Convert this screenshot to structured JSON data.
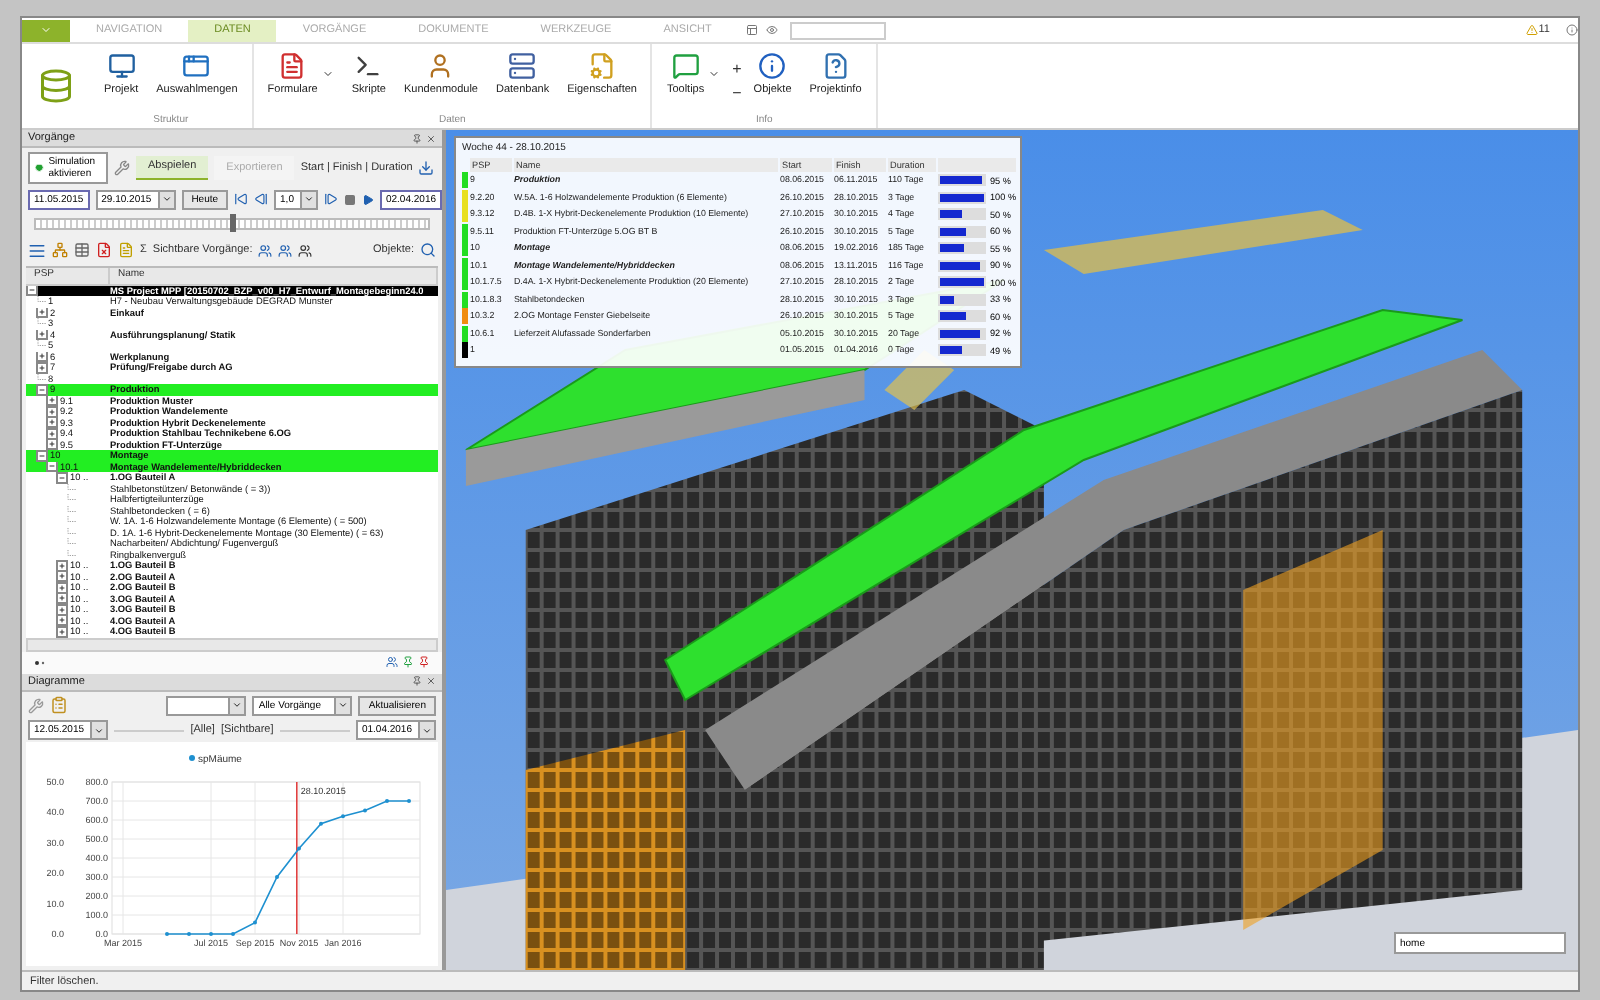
{
  "tabs": [
    {
      "label": "NAVIGATION",
      "selected": false
    },
    {
      "label": "DATEN",
      "selected": true
    },
    {
      "label": "VORGÄNGE",
      "selected": false
    },
    {
      "label": "DOKUMENTE",
      "selected": false
    },
    {
      "label": "WERKZEUGE",
      "selected": false
    },
    {
      "label": "ANSICHT",
      "selected": false
    }
  ],
  "ribbon_groups": [
    {
      "label": "Struktur",
      "buttons": [
        {
          "label": "Projekt",
          "dropdown": false
        },
        {
          "label": "Auswahlmengen",
          "dropdown": false
        }
      ]
    },
    {
      "label": "Daten",
      "buttons": [
        {
          "label": "Formulare",
          "dropdown": true
        },
        {
          "label": "Skripte",
          "dropdown": false
        },
        {
          "label": "Kundenmodule",
          "dropdown": false
        },
        {
          "label": "Datenbank",
          "dropdown": false
        },
        {
          "label": "Eigenschaften",
          "dropdown": false
        }
      ]
    },
    {
      "label": "Info",
      "buttons": [
        {
          "label": "Tooltips",
          "dropdown": true
        },
        {
          "label": "Objekte",
          "dropdown": false
        },
        {
          "label": "Projektinfo",
          "dropdown": false
        }
      ],
      "zoom_in": "+",
      "zoom_out": "−"
    }
  ],
  "warning_count": "11",
  "vorgaenge": {
    "title": "Vorgänge",
    "simulation_button": "Simulation aktivieren",
    "mode_tabs": [
      {
        "label": "Abspielen",
        "selected": true,
        "disabled": false
      },
      {
        "label": "Exportieren",
        "selected": false,
        "disabled": true
      }
    ],
    "display_mode": "Start | Finish | Duration",
    "range_start": "11.05.2015",
    "current_date": "29.10.2015",
    "today_button": "Heute",
    "speed": "1,0",
    "range_end": "02.04.2016",
    "timeline": {
      "level": 0.5
    },
    "sum_symbol": "Σ",
    "visible_tasks_label": "Sichtbare Vorgänge:",
    "objects_label": "Objekte:",
    "tree_columns": [
      "PSP",
      "Name"
    ],
    "tree": [
      {
        "kind": "folder",
        "name": "MS Project MPP [20150702_BZP_v00_H7_Entwurf_Montagebeginn24.0",
        "bold": true,
        "selected": true,
        "highlighted": false,
        "expanded": true,
        "children": [
          {
            "kind": "item",
            "psp": "1",
            "name": "H7 - Neubau Verwaltungsgebäude DEGRAD Munster",
            "bold": false,
            "selected": false,
            "highlighted": false
          },
          {
            "kind": "folder",
            "psp": "2",
            "name": "Einkauf",
            "bold": true,
            "selected": false,
            "highlighted": false,
            "expanded": false
          },
          {
            "kind": "item",
            "psp": "3",
            "selected": false,
            "highlighted": false
          },
          {
            "kind": "folder",
            "psp": "4",
            "name": "Ausführungsplanung/ Statik",
            "bold": true,
            "selected": false,
            "highlighted": false,
            "expanded": false
          },
          {
            "kind": "item",
            "psp": "5",
            "selected": false,
            "highlighted": false
          },
          {
            "kind": "folder",
            "psp": "6",
            "name": "Werkplanung",
            "bold": true,
            "selected": false,
            "highlighted": false,
            "expanded": false
          },
          {
            "kind": "folder",
            "psp": "7",
            "name": "Prüfung/Freigabe durch AG",
            "bold": true,
            "selected": false,
            "highlighted": false,
            "expanded": false
          },
          {
            "kind": "item",
            "psp": "8",
            "selected": false,
            "highlighted": false
          },
          {
            "kind": "folder",
            "psp": "9",
            "name": "Produktion",
            "bold": true,
            "selected": false,
            "highlighted": true,
            "expanded": true,
            "children": [
              {
                "kind": "folder",
                "psp": "9.1",
                "name": "Produktion Muster",
                "bold": true,
                "selected": false,
                "highlighted": false,
                "expanded": false
              },
              {
                "kind": "folder",
                "psp": "9.2",
                "name": "Produktion Wandelemente",
                "bold": true,
                "selected": false,
                "highlighted": false,
                "expanded": false
              },
              {
                "kind": "folder",
                "psp": "9.3",
                "name": "Produktion Hybrit Deckenelemente",
                "bold": true,
                "selected": false,
                "highlighted": false,
                "expanded": false
              },
              {
                "kind": "folder",
                "psp": "9.4",
                "name": "Produktion Stahlbau Technikebene 6.OG",
                "bold": true,
                "selected": false,
                "highlighted": false,
                "expanded": false
              },
              {
                "kind": "folder",
                "psp": "9.5",
                "name": "Produktion FT-Unterzüge",
                "bold": true,
                "selected": false,
                "highlighted": false,
                "expanded": false
              }
            ]
          },
          {
            "kind": "folder",
            "psp": "10",
            "name": "Montage",
            "bold": true,
            "selected": false,
            "highlighted": true,
            "expanded": true,
            "children": [
              {
                "kind": "folder",
                "psp": "10.1",
                "name": "Montage Wandelemente/Hybriddecken",
                "bold": true,
                "selected": false,
                "highlighted": true,
                "expanded": true,
                "children": [
                  {
                    "kind": "folder",
                    "psp": "10 ..",
                    "name": "1.OG Bauteil A",
                    "bold": true,
                    "selected": false,
                    "highlighted": false,
                    "expanded": true,
                    "children": [
                      {
                        "kind": "item",
                        "name": "Stahlbetonstützen/ Betonwände ( = 3))",
                        "bold": false,
                        "selected": false,
                        "highlighted": false
                      },
                      {
                        "kind": "item",
                        "name": "Halbfertigteilunterzüge",
                        "bold": false,
                        "selected": false,
                        "highlighted": false
                      },
                      {
                        "kind": "item",
                        "name": "Stahlbetondecken ( = 6)",
                        "bold": false,
                        "selected": false,
                        "highlighted": false
                      },
                      {
                        "kind": "item",
                        "name": "W. 1A. 1-6 Holzwandelemente Montage (6 Elemente) ( = 500)",
                        "bold": false,
                        "selected": false,
                        "highlighted": false
                      },
                      {
                        "kind": "item",
                        "name": "D. 1A. 1-6 Hybrit-Deckenelemente Montage (30 Elemente) ( = 63)",
                        "bold": false,
                        "selected": false,
                        "highlighted": false
                      },
                      {
                        "kind": "item",
                        "name": "Nacharbeiten/ Abdichtung/ Fugenverguß",
                        "bold": false,
                        "selected": false,
                        "highlighted": false
                      },
                      {
                        "kind": "item",
                        "name": "Ringbalkenverguß",
                        "bold": false,
                        "selected": false,
                        "highlighted": false
                      }
                    ]
                  },
                  {
                    "kind": "folder",
                    "psp": "10 ..",
                    "name": "1.OG Bauteil B",
                    "bold": true,
                    "selected": false,
                    "highlighted": false,
                    "expanded": false
                  },
                  {
                    "kind": "folder",
                    "psp": "10 ..",
                    "name": "2.OG Bauteil A",
                    "bold": true,
                    "selected": false,
                    "highlighted": false,
                    "expanded": false
                  },
                  {
                    "kind": "folder",
                    "psp": "10 ..",
                    "name": "2.OG Bauteil B",
                    "bold": true,
                    "selected": false,
                    "highlighted": false,
                    "expanded": false
                  },
                  {
                    "kind": "folder",
                    "psp": "10 ..",
                    "name": "3.OG Bauteil A",
                    "bold": true,
                    "selected": false,
                    "highlighted": false,
                    "expanded": false
                  },
                  {
                    "kind": "folder",
                    "psp": "10 ..",
                    "name": "3.OG Bauteil B",
                    "bold": true,
                    "selected": false,
                    "highlighted": false,
                    "expanded": false
                  },
                  {
                    "kind": "folder",
                    "psp": "10 ..",
                    "name": "4.OG Bauteil A",
                    "bold": true,
                    "selected": false,
                    "highlighted": false,
                    "expanded": false
                  },
                  {
                    "kind": "folder",
                    "psp": "10 ..",
                    "name": "4.OG Bauteil B",
                    "bold": true,
                    "selected": false,
                    "highlighted": false,
                    "expanded": false
                  }
                ]
              }
            ]
          }
        ]
      }
    ]
  },
  "diagramme": {
    "title": "Diagramme",
    "task_select": "Alle Vorgänge",
    "refresh_button": "Aktualisieren",
    "from_date": "12.05.2015",
    "all_label": "[Alle]",
    "visible_label": "[Sichtbare]",
    "to_date": "01.04.2016",
    "left_axis_labels": [
      "50.0",
      "40.0",
      "30.0",
      "20.0",
      "10.0",
      "0.0"
    ],
    "chart_data": {
      "type": "line",
      "categories": [
        "Mar 2015",
        null,
        null,
        null,
        "Jul 2015",
        null,
        "Sep 2015",
        null,
        "Nov 2015",
        null,
        "Jan 2016",
        null,
        null,
        null
      ],
      "series": [
        {
          "name": "spMäume",
          "color": "#1e90d0",
          "values": [
            null,
            null,
            0,
            0,
            0,
            0,
            60,
            300,
            450,
            580,
            620,
            650,
            700,
            700
          ]
        }
      ],
      "ylim": [
        0,
        800
      ],
      "yticks": [
        {
          "value": 0,
          "label": "0.0"
        },
        {
          "value": 100,
          "label": "100.0"
        },
        {
          "value": 200,
          "label": "200.0"
        },
        {
          "value": 300,
          "label": "300.0"
        },
        {
          "value": 400,
          "label": "400.0"
        },
        {
          "value": 500,
          "label": "500.0"
        },
        {
          "value": 600,
          "label": "600.0"
        },
        {
          "value": 700,
          "label": "700.0"
        },
        {
          "value": 800,
          "label": "800.0"
        }
      ],
      "grid": true,
      "annotations": [
        "28.10.2015"
      ]
    }
  },
  "week_popup": {
    "title": "Woche 44 - 28.10.2015",
    "columns": [
      "PSP",
      "Name",
      "Start",
      "Finish",
      "Duration"
    ],
    "rows": [
      {
        "psp": "9",
        "name": "Produktion",
        "bold": true,
        "start": "08.06.2015",
        "finish": "06.11.2015",
        "duration": "110 Tage",
        "level": 0.95,
        "percent": "95 %",
        "color": "#22dd22"
      },
      {
        "psp": "9.2.20",
        "name": "W.5A. 1-6 Holzwandelemente Produktion (6 Elemente)",
        "bold": false,
        "start": "26.10.2015",
        "finish": "28.10.2015",
        "duration": "3 Tage",
        "level": 1,
        "percent": "100 %",
        "color": "#e8e020"
      },
      {
        "psp": "9.3.12",
        "name": "D.4B. 1-X Hybrit-Deckenelemente Produktion (10 Elemente)",
        "bold": false,
        "start": "27.10.2015",
        "finish": "30.10.2015",
        "duration": "4 Tage",
        "level": 0.5,
        "percent": "50 %",
        "color": "#e8e020"
      },
      {
        "psp": "9.5.11",
        "name": "Produktion FT-Unterzüge 5.OG BT B",
        "bold": false,
        "start": "26.10.2015",
        "finish": "30.10.2015",
        "duration": "5 Tage",
        "level": 0.6,
        "percent": "60 %",
        "color": "#22dd22"
      },
      {
        "psp": "10",
        "name": "Montage",
        "bold": true,
        "start": "08.06.2015",
        "finish": "19.02.2016",
        "duration": "185 Tage",
        "level": 0.55,
        "percent": "55 %",
        "color": "#22dd22"
      },
      {
        "psp": "10.1",
        "name": "Montage Wandelemente/Hybriddecken",
        "bold": true,
        "start": "08.06.2015",
        "finish": "13.11.2015",
        "duration": "116 Tage",
        "level": 0.9,
        "percent": "90 %",
        "color": "#22dd22"
      },
      {
        "psp": "10.1.7.5",
        "name": "D.4A. 1-X Hybrit-Deckenelemente Produktion (20 Elemente)",
        "bold": false,
        "start": "27.10.2015",
        "finish": "28.10.2015",
        "duration": "2 Tage",
        "level": 1,
        "percent": "100 %",
        "color": "#22dd22"
      },
      {
        "psp": "10.1.8.3",
        "name": "Stahlbetondecken",
        "bold": false,
        "start": "28.10.2015",
        "finish": "30.10.2015",
        "duration": "3 Tage",
        "level": 0.33,
        "percent": "33 %",
        "color": "#22dd22"
      },
      {
        "psp": "10.3.2",
        "name": "2.OG Montage Fenster Giebelseite",
        "bold": false,
        "start": "26.10.2015",
        "finish": "30.10.2015",
        "duration": "5 Tage",
        "level": 0.6,
        "percent": "60 %",
        "color": "#f08c10"
      },
      {
        "psp": "10.6.1",
        "name": "Lieferzeit Alufassade Sonderfarben",
        "bold": false,
        "start": "05.10.2015",
        "finish": "30.10.2015",
        "duration": "20 Tage",
        "level": 0.92,
        "percent": "92 %",
        "color": "#22dd22"
      },
      {
        "psp": "1",
        "start": "01.05.2015",
        "finish": "01.04.2016",
        "duration": "0 Tage",
        "level": 0.49,
        "percent": "49 %",
        "color": "#000000"
      }
    ]
  },
  "view_search": {
    "value": "home"
  },
  "status_bar": "Filter löschen."
}
